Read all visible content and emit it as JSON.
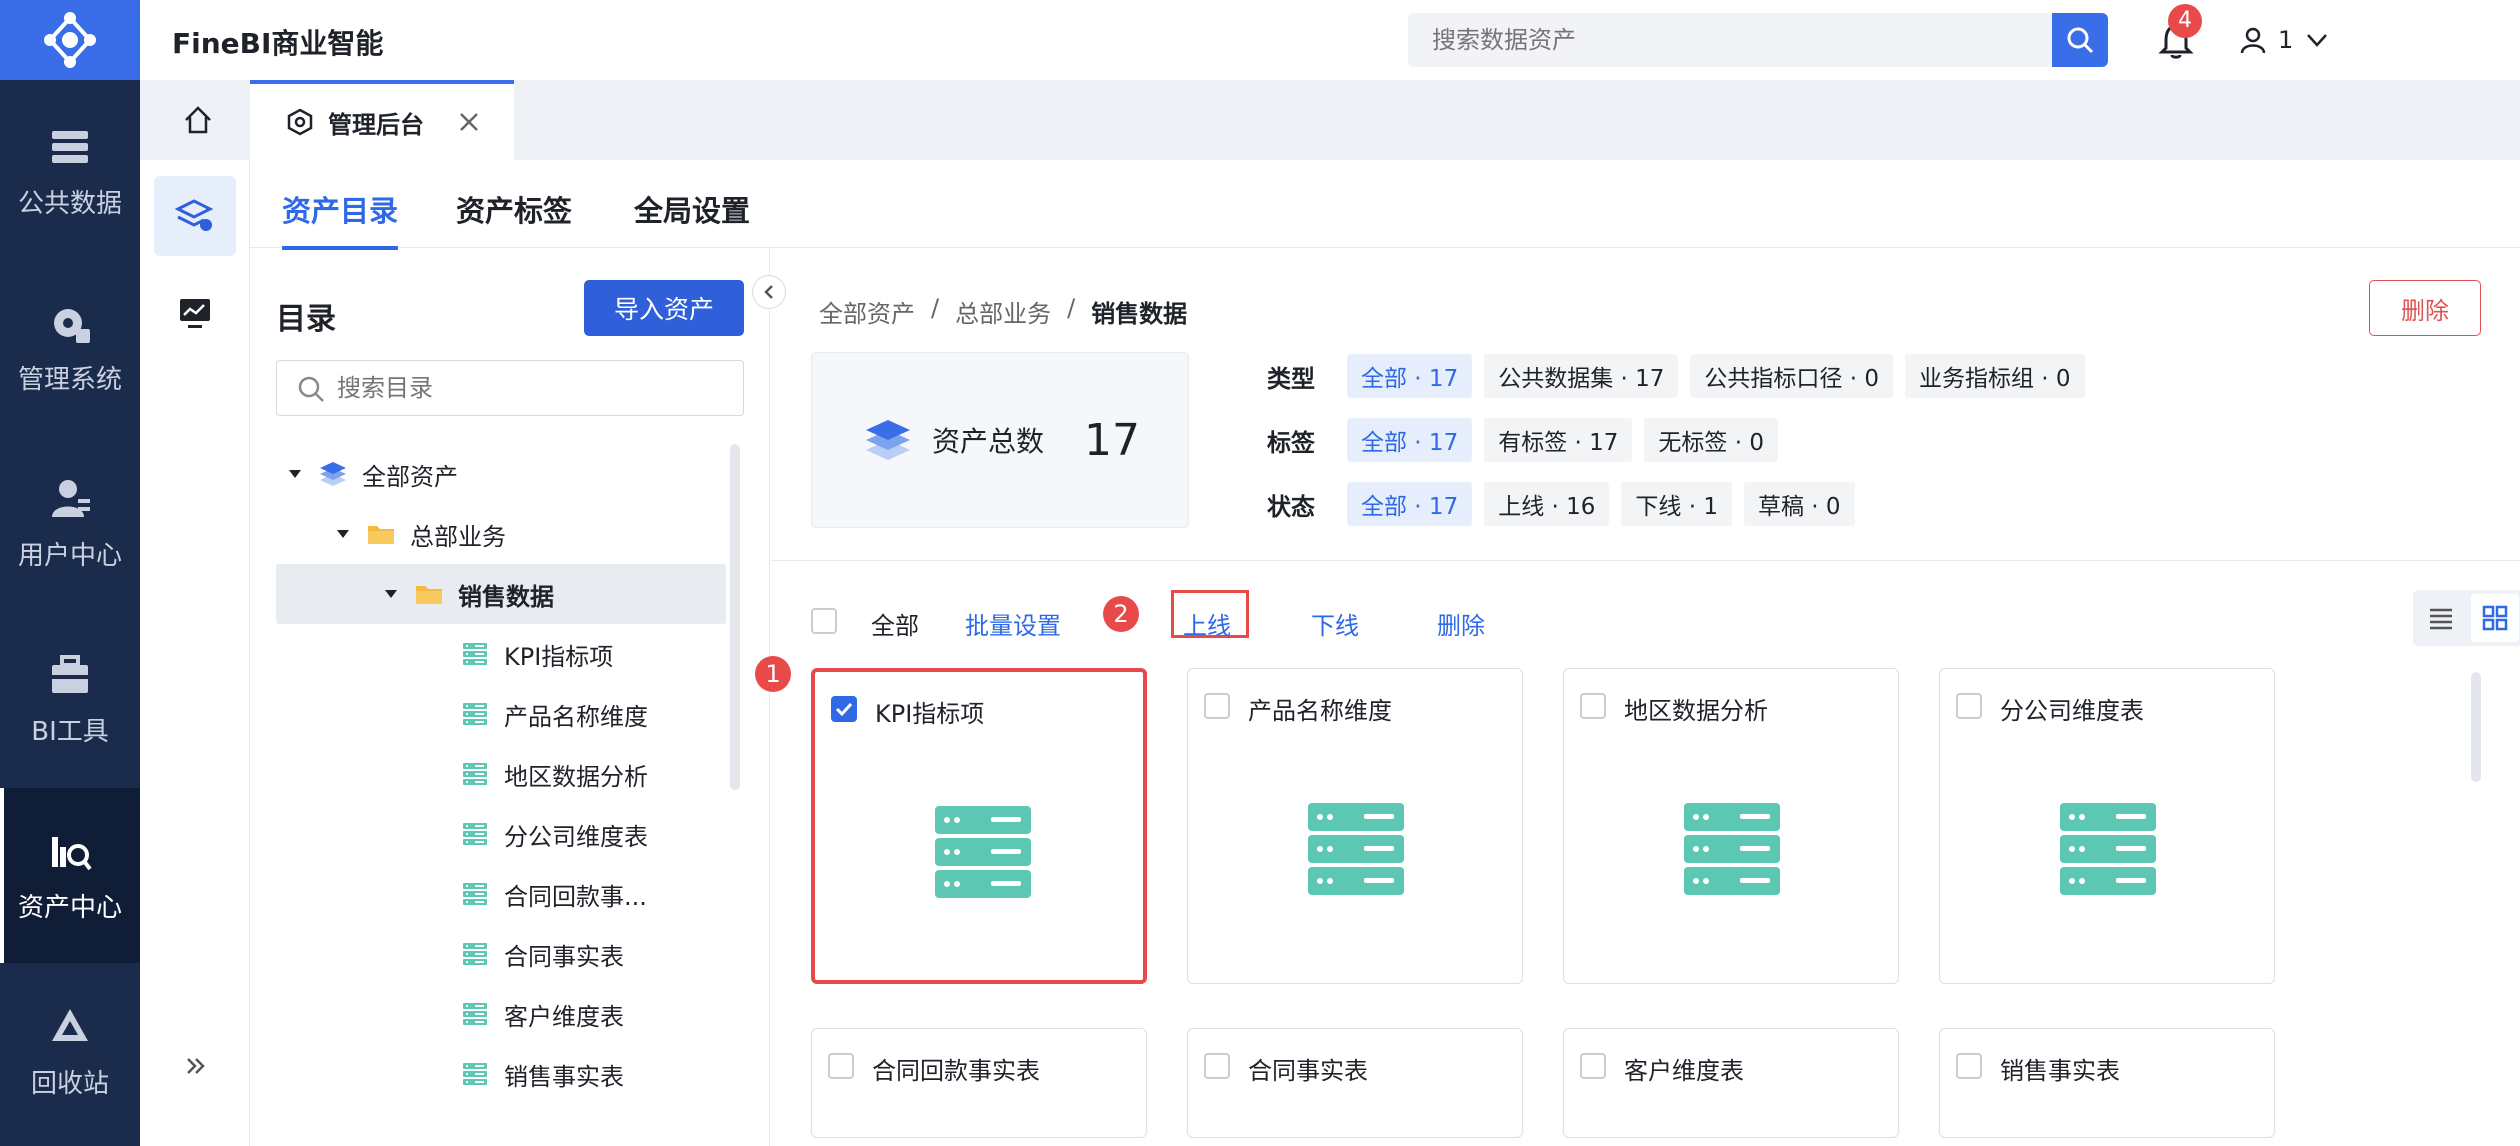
{
  "app": {
    "title": "FineBI商业智能"
  },
  "leftnav": [
    {
      "label": "公共数据",
      "icon": "database-icon"
    },
    {
      "label": "管理系统",
      "icon": "gear-icon"
    },
    {
      "label": "用户中心",
      "icon": "user-icon"
    },
    {
      "label": "BI工具",
      "icon": "toolbox-icon"
    },
    {
      "label": "资产中心",
      "icon": "asset-search-icon",
      "active": true
    },
    {
      "label": "回收站",
      "icon": "recycle-icon"
    }
  ],
  "search": {
    "placeholder": "搜索数据资产"
  },
  "notifications": {
    "count": "4"
  },
  "user": {
    "name": "1"
  },
  "tabs": {
    "admin": "管理后台"
  },
  "subtabs": [
    "资产目录",
    "资产标签",
    "全局设置"
  ],
  "directory": {
    "title": "目录",
    "import_button": "导入资产",
    "search_placeholder": "搜索目录",
    "tree": [
      {
        "label": "全部资产",
        "level": 0,
        "type": "layers"
      },
      {
        "label": "总部业务",
        "level": 1,
        "type": "folder"
      },
      {
        "label": "销售数据",
        "level": 2,
        "type": "folder",
        "selected": true
      },
      {
        "label": "KPI指标项",
        "level": 3,
        "type": "table"
      },
      {
        "label": "产品名称维度",
        "level": 3,
        "type": "table"
      },
      {
        "label": "地区数据分析",
        "level": 3,
        "type": "table"
      },
      {
        "label": "分公司维度表",
        "level": 3,
        "type": "table"
      },
      {
        "label": "合同回款事...",
        "level": 3,
        "type": "table"
      },
      {
        "label": "合同事实表",
        "level": 3,
        "type": "table"
      },
      {
        "label": "客户维度表",
        "level": 3,
        "type": "table"
      },
      {
        "label": "销售事实表",
        "level": 3,
        "type": "table"
      }
    ]
  },
  "breadcrumb": {
    "root": "全部资产",
    "sep": "/",
    "mid": "总部业务",
    "current": "销售数据"
  },
  "delete_button": "删除",
  "summary": {
    "label": "资产总数",
    "value": "17"
  },
  "filters": {
    "type": {
      "label": "类型",
      "chips": [
        "全部 · 17",
        "公共数据集 · 17",
        "公共指标口径 · 0",
        "业务指标组 · 0"
      ]
    },
    "tag": {
      "label": "标签",
      "chips": [
        "全部 · 17",
        "有标签 · 17",
        "无标签 · 0"
      ]
    },
    "status": {
      "label": "状态",
      "chips": [
        "全部 · 17",
        "上线 · 16",
        "下线 · 1",
        "草稿 · 0"
      ]
    }
  },
  "toolbar": {
    "all": "全部",
    "batch": "批量设置",
    "online": "上线",
    "offline": "下线",
    "delete": "删除"
  },
  "markers": {
    "one": "1",
    "two": "2"
  },
  "cards": [
    {
      "title": "KPI指标项",
      "checked": true
    },
    {
      "title": "产品名称维度",
      "checked": false
    },
    {
      "title": "地区数据分析",
      "checked": false
    },
    {
      "title": "分公司维度表",
      "checked": false
    },
    {
      "title": "合同回款事实表",
      "checked": false
    },
    {
      "title": "合同事实表",
      "checked": false
    },
    {
      "title": "客户维度表",
      "checked": false
    },
    {
      "title": "销售事实表",
      "checked": false
    }
  ],
  "colors": {
    "primary": "#2f6ae6",
    "nav_bg": "#1a2b4c",
    "highlight": "#e84a4a",
    "teal": "#5cc8b4"
  }
}
